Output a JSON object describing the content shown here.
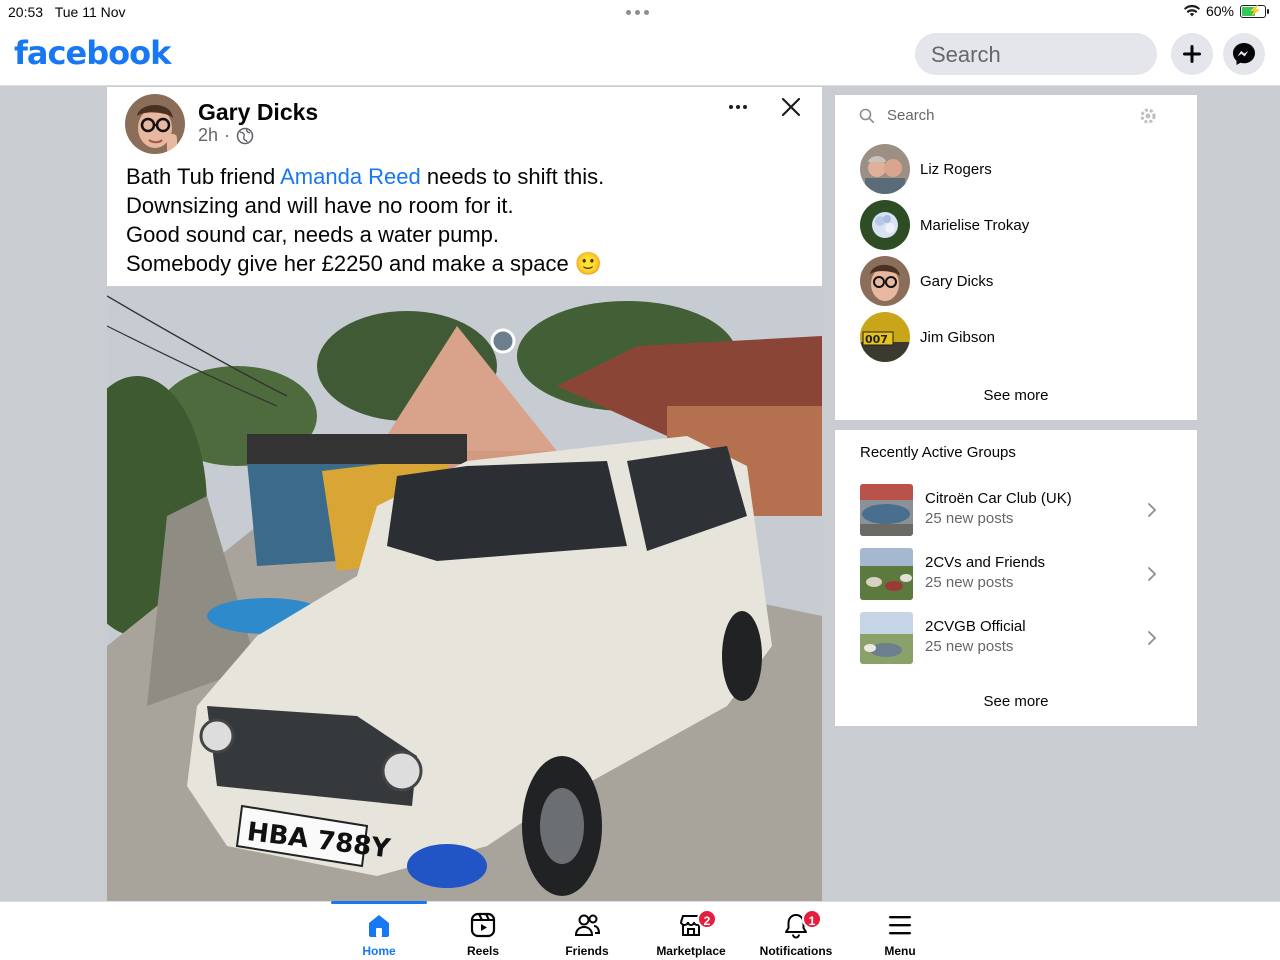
{
  "status_bar": {
    "time": "20:53",
    "date": "Tue 11 Nov",
    "battery_percent": "60%",
    "battery_level": 0.6
  },
  "header": {
    "logo": "facebook",
    "search_placeholder": "Search",
    "brand_color": "#1877f2",
    "icons": [
      "plus-icon",
      "messenger-icon"
    ]
  },
  "post": {
    "author": "Gary Dicks",
    "time": "2h",
    "separator": "·",
    "audience_icon": "globe-icon",
    "text_lines": [
      {
        "before": "Bath Tub friend ",
        "mention": "Amanda Reed",
        "after": " needs to shift this."
      },
      "Downsizing and will have no room for it.",
      "Good sound car, needs a water pump.",
      "Somebody give her £2250 and make a space 🙂"
    ],
    "photo_license_plate": "HBA 788Y"
  },
  "contacts": {
    "search_placeholder": "Search",
    "items": [
      {
        "name": "Liz Rogers"
      },
      {
        "name": "Marielise Trokay"
      },
      {
        "name": "Gary Dicks"
      },
      {
        "name": "Jim Gibson"
      }
    ],
    "see_more": "See more"
  },
  "groups": {
    "title": "Recently Active Groups",
    "items": [
      {
        "name": "Citroën Car Club (UK)",
        "sub": "25 new posts"
      },
      {
        "name": "2CVs and Friends",
        "sub": "25 new posts"
      },
      {
        "name": "2CVGB Official",
        "sub": "25 new posts"
      }
    ],
    "see_more": "See more"
  },
  "tabbar": {
    "tabs": [
      {
        "label": "Home",
        "icon": "home-icon",
        "active": true
      },
      {
        "label": "Reels",
        "icon": "reels-icon"
      },
      {
        "label": "Friends",
        "icon": "friends-icon"
      },
      {
        "label": "Marketplace",
        "icon": "marketplace-icon",
        "badge": "2"
      },
      {
        "label": "Notifications",
        "icon": "bell-icon",
        "badge": "1"
      },
      {
        "label": "Menu",
        "icon": "menu-icon"
      }
    ],
    "badge_color": "#e41e3f"
  }
}
